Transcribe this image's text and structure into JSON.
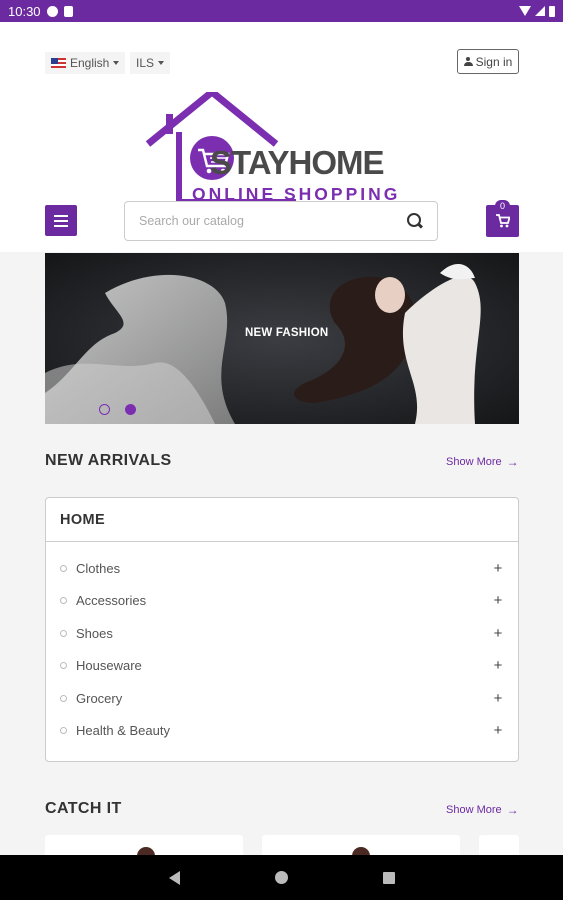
{
  "status_bar": {
    "time": "10:30"
  },
  "header": {
    "language": "English",
    "currency": "ILS",
    "sign_in": "Sign in",
    "logo_line1": "STAYHOME",
    "logo_line2": "ONLINE SHOPPING",
    "search_placeholder": "Search our catalog",
    "cart_count": "0"
  },
  "banner": {
    "text": "NEW FASHION",
    "slides": 2,
    "active_slide": 2
  },
  "new_arrivals": {
    "title": "NEW ARRIVALS",
    "show_more": "Show More",
    "category_card": {
      "title": "HOME",
      "items": [
        {
          "label": "Clothes"
        },
        {
          "label": "Accessories"
        },
        {
          "label": "Shoes"
        },
        {
          "label": "Houseware"
        },
        {
          "label": "Grocery"
        },
        {
          "label": "Health & Beauty"
        }
      ]
    }
  },
  "catch_it": {
    "title": "CATCH IT",
    "show_more": "Show More"
  },
  "colors": {
    "brand": "#6c2aa0",
    "accent": "#7b2fb0"
  },
  "icons": [
    "menu-icon",
    "search-icon",
    "cart-icon",
    "user-icon",
    "flag-us-icon"
  ]
}
